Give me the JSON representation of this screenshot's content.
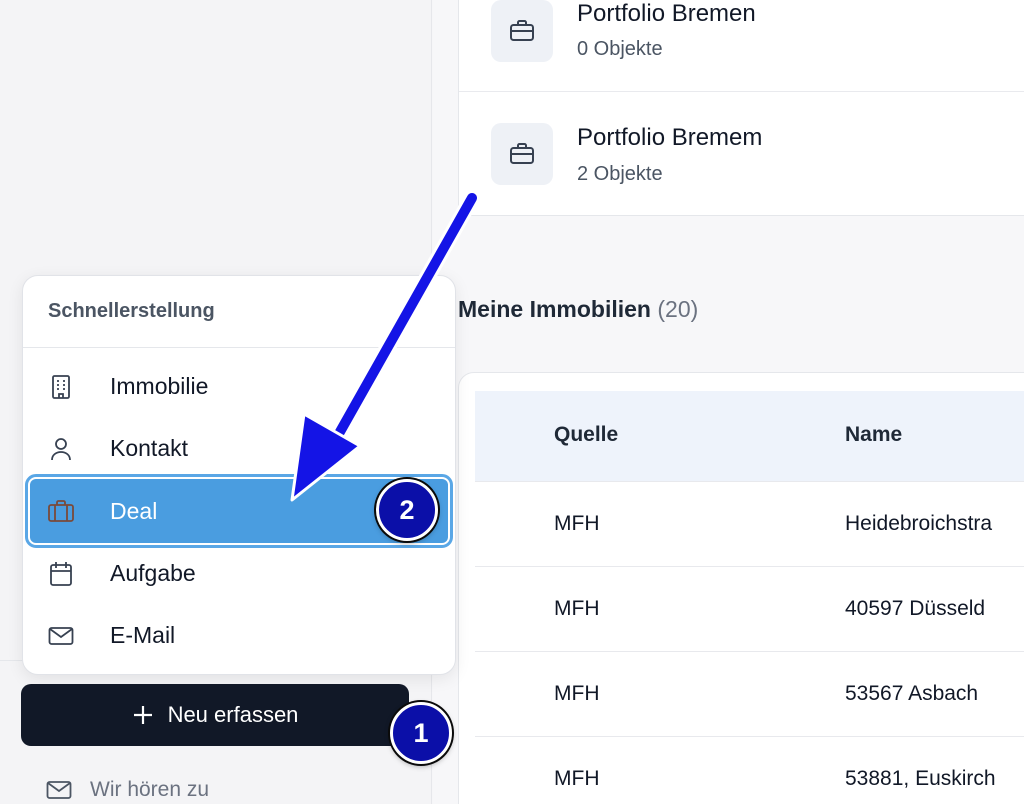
{
  "portfolios": [
    {
      "name": "Portfolio Bremen",
      "count": "0 Objekte",
      "icon": "briefcase-icon"
    },
    {
      "name": "Portfolio Bremem",
      "count": "2 Objekte",
      "icon": "briefcase-icon"
    }
  ],
  "section": {
    "title": "Meine Immobilien",
    "count": "(20)"
  },
  "table": {
    "headers": [
      "Quelle",
      "Name"
    ],
    "rows": [
      [
        "MFH",
        "Heidebroichstra"
      ],
      [
        "MFH",
        "40597 Düsseld"
      ],
      [
        "MFH",
        "53567 Asbach"
      ],
      [
        "MFH",
        "53881, Euskirch"
      ]
    ]
  },
  "quick_create": {
    "title": "Schnellerstellung",
    "items": [
      {
        "label": "Immobilie",
        "icon": "building-icon"
      },
      {
        "label": "Kontakt",
        "icon": "user-icon"
      },
      {
        "label": "Deal",
        "icon": "briefcase-icon",
        "selected": true
      },
      {
        "label": "Aufgabe",
        "icon": "calendar-icon"
      },
      {
        "label": "E-Mail",
        "icon": "mail-icon"
      }
    ]
  },
  "new_button": {
    "label": "Neu erfassen",
    "icon": "plus-icon"
  },
  "feedback": {
    "label": "Wir hören zu",
    "icon": "mail-icon"
  },
  "badges": {
    "one": "1",
    "two": "2"
  },
  "colors": {
    "accent_selected": "#4a9de0",
    "badge": "#0b0fa8",
    "arrow": "#1414e6",
    "button_dark": "#111827",
    "table_header_bg": "#eef3fb"
  }
}
